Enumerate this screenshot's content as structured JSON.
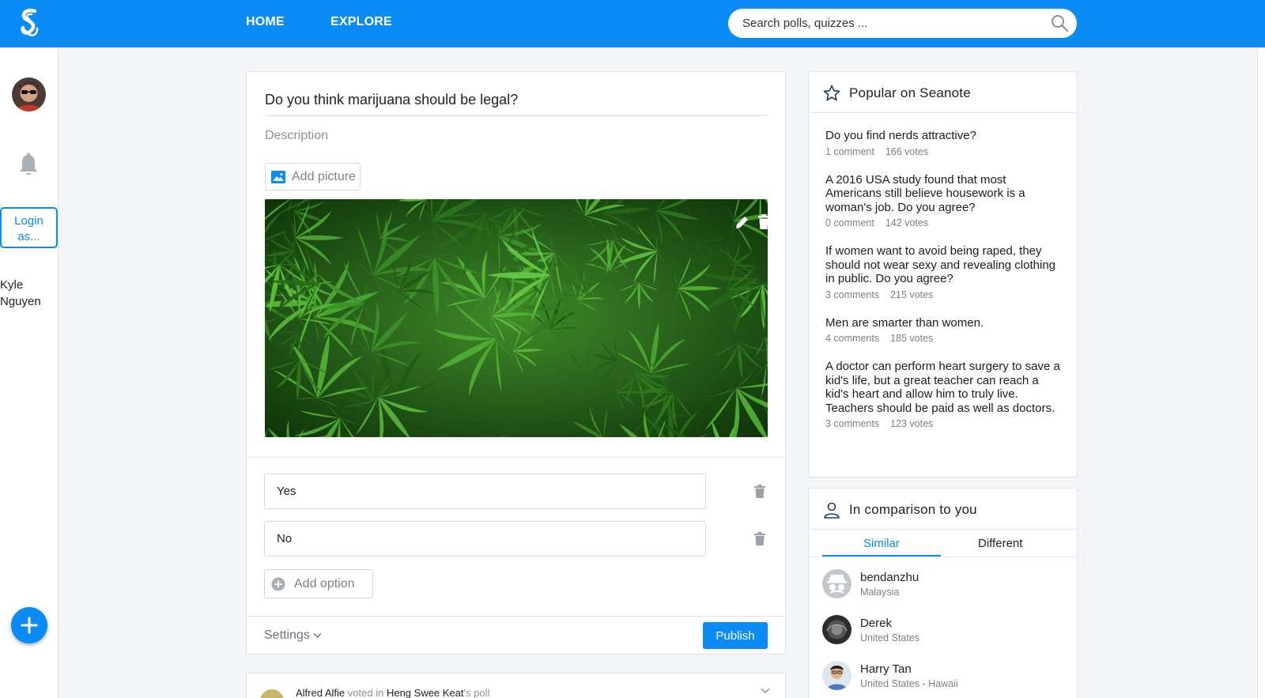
{
  "nav": {
    "home": "HOME",
    "explore": "EXPLORE",
    "search_placeholder": "Search polls, quizzes ..."
  },
  "leftrail": {
    "login_line1": "Login",
    "login_line2": "as...",
    "user_first": "Kyle",
    "user_last": "Nguyen"
  },
  "composer": {
    "question": "Do you think marijuana should be legal?",
    "description_placeholder": "Description",
    "add_picture": "Add picture",
    "options": [
      "Yes",
      "No"
    ],
    "add_option": "Add option",
    "settings": "Settings",
    "publish": "Publish"
  },
  "feed": {
    "actor": "Alfred Alfie",
    "verb": "voted in",
    "owner": "Heng Swee Keat",
    "suffix": "'s poll"
  },
  "popular": {
    "title": "Popular on Seanote",
    "items": [
      {
        "question": "Do you find nerds attractive?",
        "comments": "1 comment",
        "votes": "166 votes"
      },
      {
        "question": "A 2016 USA study found that most Americans still believe housework is a woman's job. Do you agree?",
        "comments": "0 comment",
        "votes": "142 votes"
      },
      {
        "question": "If women want to avoid being raped, they should not wear sexy and revealing clothing in public. Do you agree?",
        "comments": "3 comments",
        "votes": "215 votes"
      },
      {
        "question": "Men are smarter than women.",
        "comments": "4 comments",
        "votes": "185 votes"
      },
      {
        "question": "A doctor can perform heart surgery to save a kid's life, but a great teacher can reach a kid's heart and allow him to truly live. Teachers should be paid as well as doctors.",
        "comments": "3 comments",
        "votes": "123 votes"
      }
    ]
  },
  "comparison": {
    "title": "In comparison to you",
    "tab_similar": "Similar",
    "tab_different": "Different",
    "people": [
      {
        "name": "bendanzhu",
        "location": "Malaysia"
      },
      {
        "name": "Derek",
        "location": "United States"
      },
      {
        "name": "Harry Tan",
        "location": "United States - Hawaii"
      }
    ]
  },
  "colors": {
    "brand": "#0a8bf5",
    "background": "#f4f5f7"
  }
}
